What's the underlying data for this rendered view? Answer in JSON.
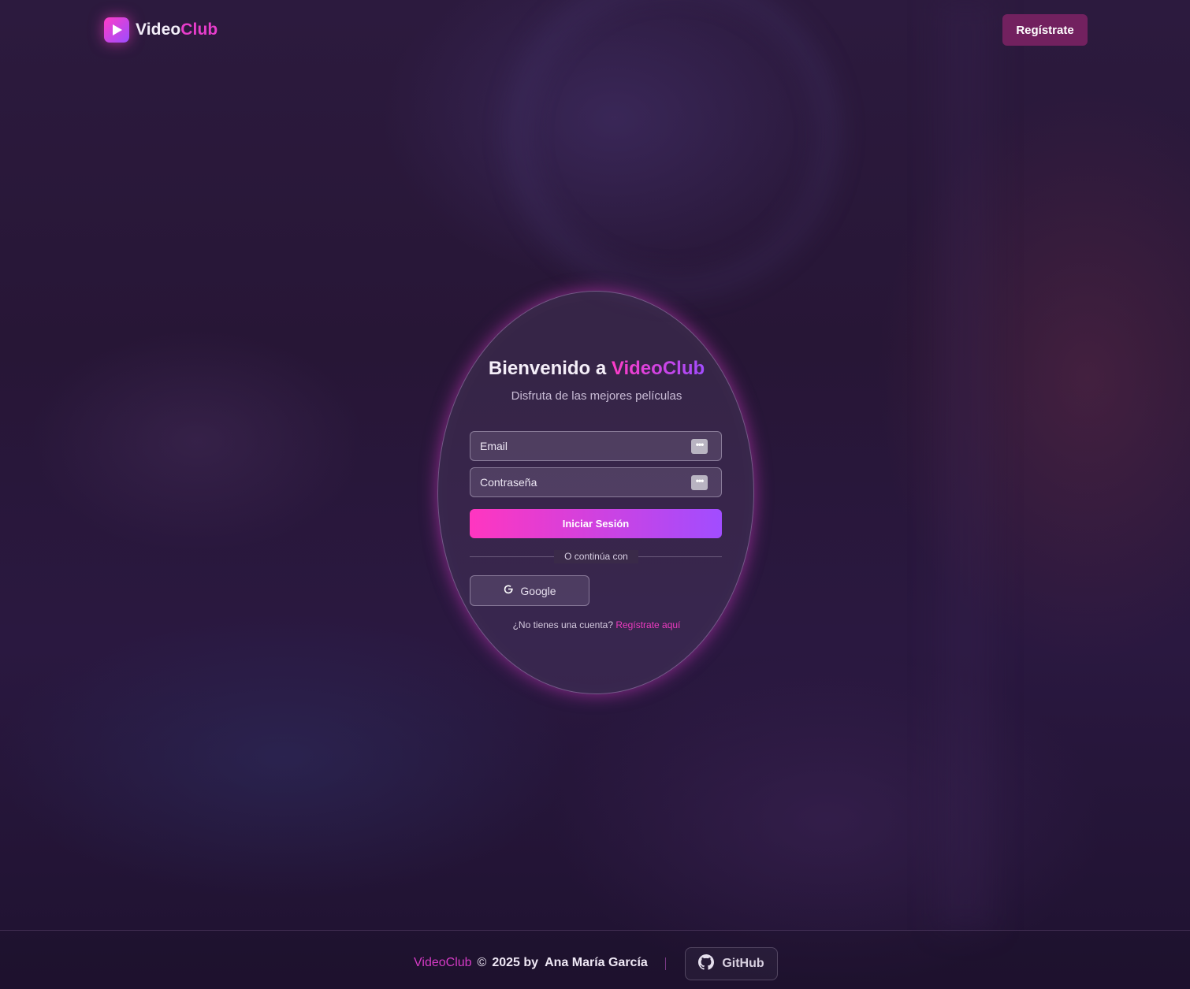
{
  "header": {
    "logo": {
      "part1": "Video",
      "part2": "Club"
    },
    "register_button": "Regístrate"
  },
  "login_card": {
    "title_prefix": "Bienvenido a",
    "title_brand": "VideoClub",
    "subtitle": "Disfruta de las mejores películas",
    "email_placeholder": "Email",
    "password_placeholder": "Contraseña",
    "submit_label": "Iniciar Sesión",
    "divider_text": "O continúa con",
    "google_label": "Google",
    "no_account_text": "¿No tienes una cuenta?",
    "register_link": "Regístrate aquí"
  },
  "footer": {
    "brand": "VideoClub",
    "copyright_symbol": "©",
    "year_by": "2025 by",
    "author": "Ana María García",
    "github_label": "GitHub"
  },
  "colors": {
    "accent_pink": "#ff3cc7",
    "accent_purple": "#a14dff",
    "register_button_bg": "#72215f",
    "background": "#241432"
  }
}
